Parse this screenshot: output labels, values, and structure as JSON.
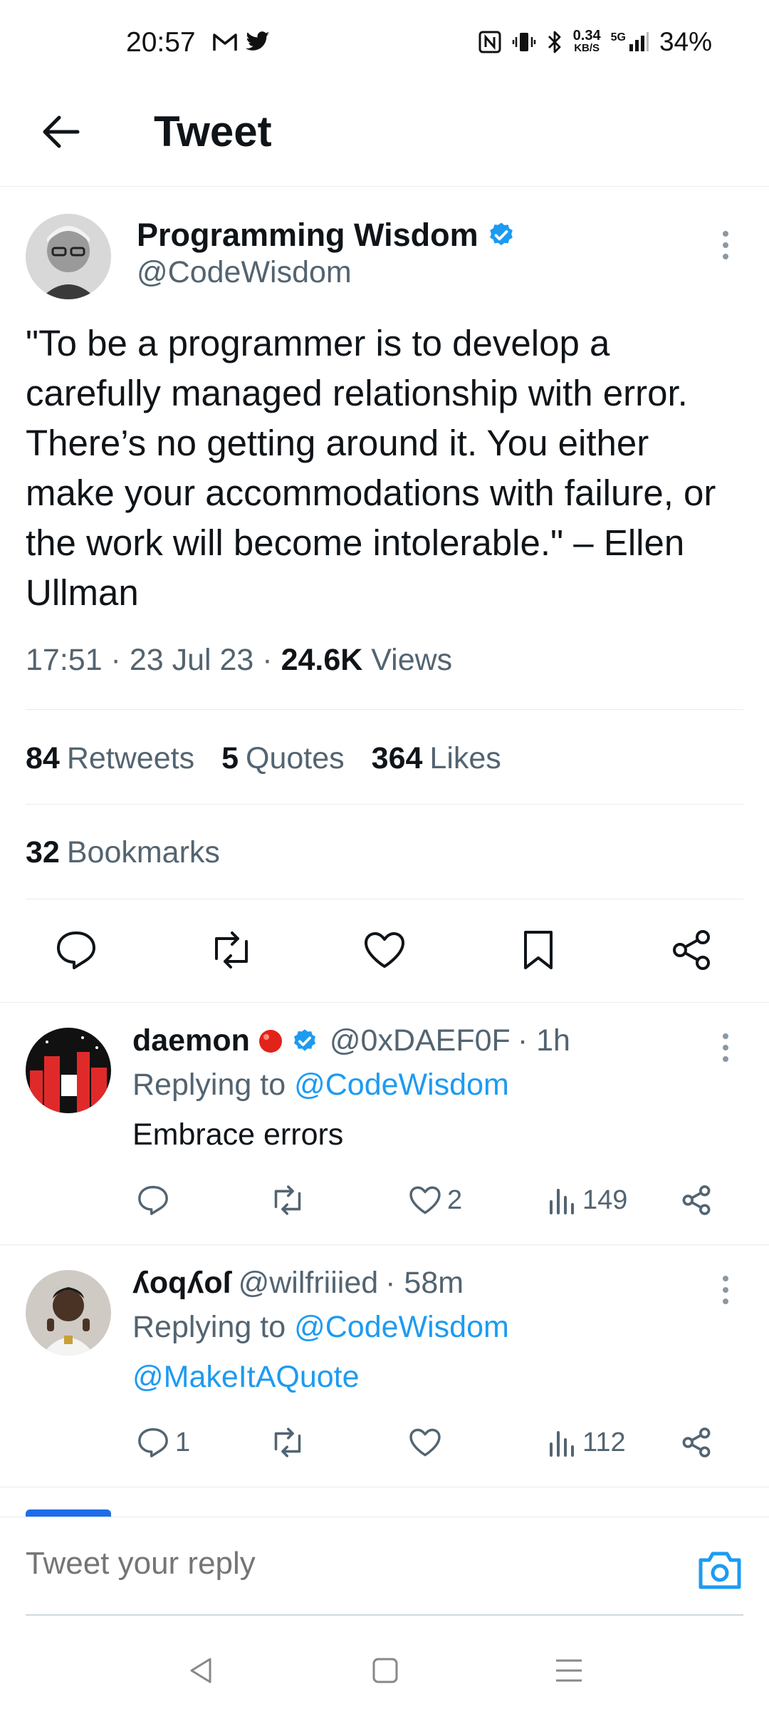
{
  "status_bar": {
    "time": "20:57",
    "speed_value": "0.34",
    "speed_unit": "KB/S",
    "network": "5G",
    "battery": "34%"
  },
  "app_bar": {
    "title": "Tweet"
  },
  "tweet": {
    "author_name": "Programming Wisdom",
    "author_handle": "@CodeWisdom",
    "text": "\"To be a programmer is to develop a carefully managed relationship with error. There’s no getting around it. You either make your accommodations with failure, or the work will become intolerable.\" – Ellen Ullman",
    "time": "17:51 · 23 Jul 23 · ",
    "views_count": "24.6K",
    "views_label": " Views",
    "retweets_count": "84",
    "retweets_label": "Retweets",
    "quotes_count": "5",
    "quotes_label": "Quotes",
    "likes_count": "364",
    "likes_label": "Likes",
    "bookmarks_count": "32",
    "bookmarks_label": "Bookmarks"
  },
  "replies": [
    {
      "name": "daemon",
      "handle": "@0xDAEF0F",
      "time": "· 1h",
      "replying_prefix": "Replying to",
      "replying_to": "@CodeWisdom",
      "body": "Embrace errors",
      "reply_count": "",
      "like_count": "2",
      "views_count": "149"
    },
    {
      "name": "ʎoqʎoſ",
      "handle": "@wilfriiied",
      "time": "· 58m",
      "replying_prefix": "Replying to",
      "replying_to": "@CodeWisdom",
      "body": "@MakeItAQuote",
      "reply_count": "1",
      "like_count": "",
      "views_count": "112"
    }
  ],
  "composer": {
    "placeholder": "Tweet your reply"
  },
  "colors": {
    "accent": "#1d9bf0",
    "text": "#0f1419",
    "secondary": "#536471",
    "divider": "#e6ecf0"
  },
  "icons": [
    "back-arrow-icon",
    "verified-badge-icon",
    "more-icon",
    "reply-icon",
    "retweet-icon",
    "like-icon",
    "bookmark-icon",
    "share-icon",
    "views-icon",
    "camera-icon",
    "nav-back-icon",
    "nav-home-icon",
    "nav-menu-icon",
    "gmail-icon",
    "twitter-icon",
    "nfc-icon",
    "vibrate-icon",
    "bluetooth-icon",
    "signal-icon"
  ]
}
